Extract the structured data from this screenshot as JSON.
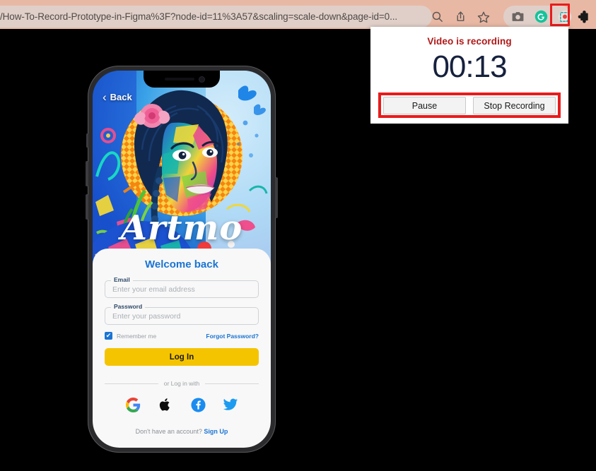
{
  "browser": {
    "url": "/How-To-Record-Prototype-in-Figma%3F?node-id=11%3A57&scaling=scale-down&page-id=0...",
    "toolbar_icons": [
      {
        "name": "zoom-out-icon",
        "glyph": "search"
      },
      {
        "name": "share-icon",
        "glyph": "share"
      },
      {
        "name": "bookmark-star-icon",
        "glyph": "star"
      }
    ],
    "extension_icons": [
      {
        "name": "screenshot-camera-icon",
        "glyph": "camera"
      },
      {
        "name": "grammarly-icon",
        "glyph": "G"
      },
      {
        "name": "screen-recorder-icon",
        "glyph": "record"
      }
    ],
    "puzzle_icon_name": "extensions-puzzle-icon",
    "highlight_color": "#e81c1c"
  },
  "popup": {
    "status_text": "Video is recording",
    "status_color": "#b01818",
    "timer": "00:13",
    "timer_color": "#16213d",
    "pause_label": "Pause",
    "stop_label": "Stop Recording",
    "annotation_color": "#e81c1c"
  },
  "phone": {
    "hero": {
      "back_label": "Back",
      "back_chevron": "‹",
      "brand_word": "Artmo"
    },
    "login": {
      "title": "Welcome back",
      "title_color": "#1a74d4",
      "email_label": "Email",
      "email_placeholder": "Enter your email address",
      "email_value": "",
      "password_label": "Password",
      "password_placeholder": "Enter your password",
      "password_value": "",
      "remember_label": "Remember me",
      "remember_checked_glyph": "✔",
      "forgot_label": "Forgot Password?",
      "login_button_label": "Log In",
      "login_button_color": "#f5c400",
      "divider_label": "or Log in with",
      "socials": [
        {
          "name": "google-icon",
          "label": "Google"
        },
        {
          "name": "apple-icon",
          "label": "Apple"
        },
        {
          "name": "facebook-icon",
          "label": "Facebook"
        },
        {
          "name": "twitter-icon",
          "label": "Twitter"
        }
      ],
      "signup_prompt": "Don't have an account?",
      "signup_link": "Sign Up"
    }
  }
}
